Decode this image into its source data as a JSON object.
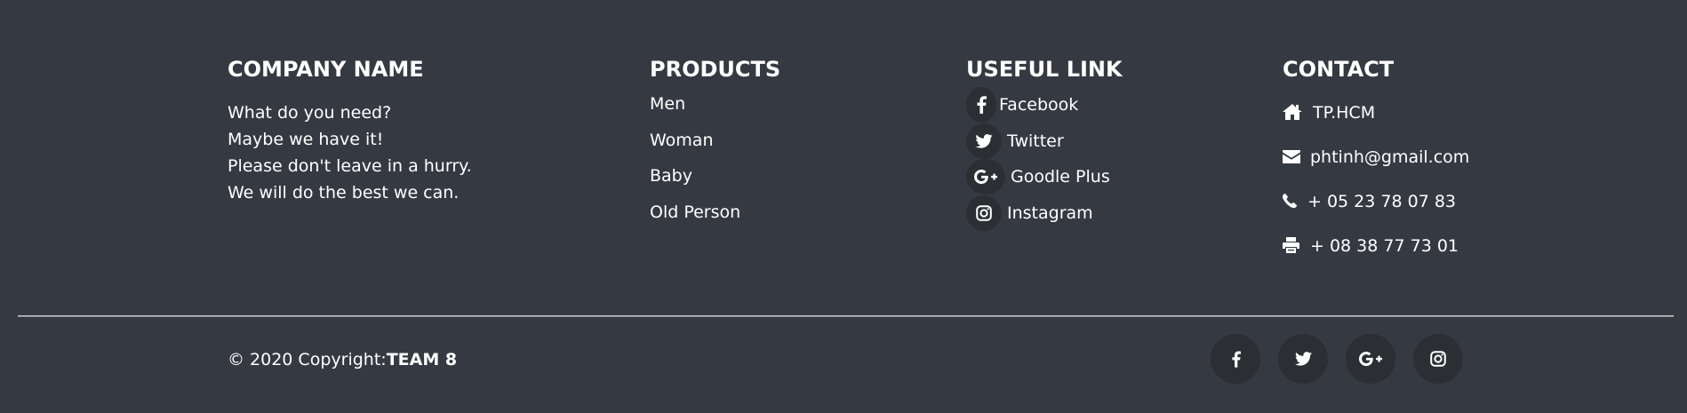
{
  "company": {
    "heading": "COMPANY NAME",
    "lines": [
      "What do you need?",
      "Maybe we have it!",
      "Please don't leave in a hurry.",
      "We will do the best we can."
    ]
  },
  "products": {
    "heading": "PRODUCTS",
    "items": [
      "Men",
      "Woman",
      "Baby",
      "Old Person"
    ]
  },
  "useful": {
    "heading": "USEFUL LINK",
    "items": [
      {
        "label": "Facebook",
        "icon": "facebook-icon"
      },
      {
        "label": "Twitter",
        "icon": "twitter-icon"
      },
      {
        "label": "Goodle Plus",
        "icon": "google-plus-icon"
      },
      {
        "label": "Instagram",
        "icon": "instagram-icon"
      }
    ]
  },
  "contact": {
    "heading": "CONTACT",
    "items": [
      {
        "label": "TP.HCM",
        "icon": "home-icon"
      },
      {
        "label": "phtinh@gmail.com",
        "icon": "envelope-icon"
      },
      {
        "label": "+ 05 23 78 07 83",
        "icon": "phone-icon"
      },
      {
        "label": "+ 08 38 77 73 01",
        "icon": "print-icon"
      }
    ]
  },
  "footer": {
    "copyright_prefix": "© 2020 Copyright:",
    "copyright_team": "TEAM 8",
    "social": [
      {
        "icon": "facebook-icon"
      },
      {
        "icon": "twitter-icon"
      },
      {
        "icon": "google-plus-icon"
      },
      {
        "icon": "instagram-icon"
      }
    ]
  },
  "colors": {
    "background": "#353a42",
    "icon_circle": "#2b2e33",
    "text": "#ffffff"
  }
}
